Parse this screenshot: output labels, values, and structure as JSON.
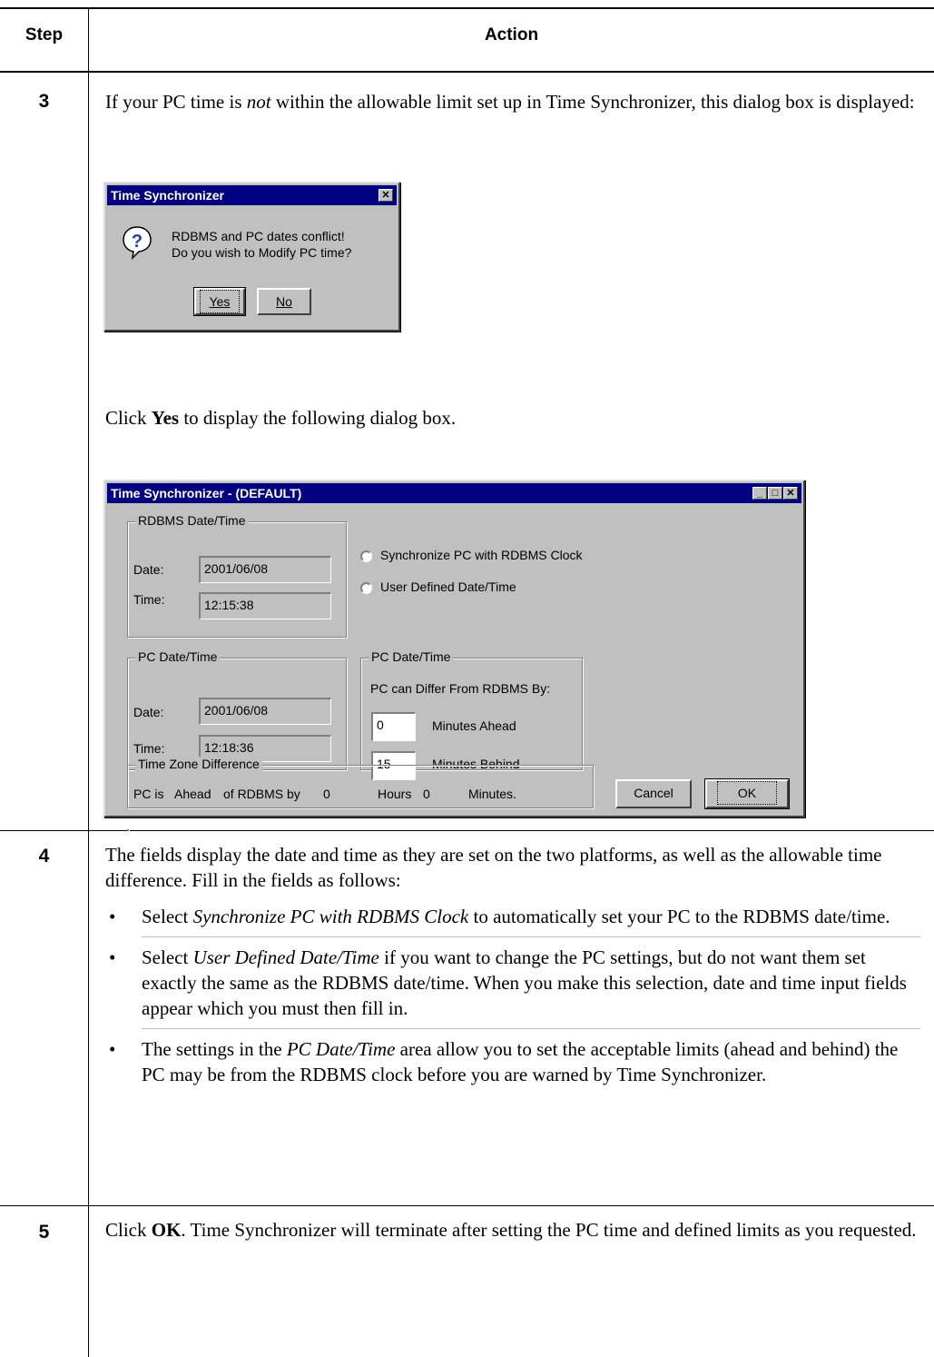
{
  "table": {
    "header_step": "Step",
    "header_action": "Action"
  },
  "step3": {
    "number": "3",
    "intro_before": "If your PC time is ",
    "intro_italic": "not",
    "intro_after": " within the allowable limit set up in Time Synchronizer, this dialog box is displayed:",
    "click_before": "Click ",
    "click_bold": "Yes",
    "click_after": " to display the following dialog box."
  },
  "confirm_dialog": {
    "title": "Time Synchronizer",
    "message_line1": "RDBMS and PC dates conflict!",
    "message_line2": "Do you wish to Modify PC time?",
    "yes_label": "Yes",
    "no_label": "No",
    "icon": "question-icon"
  },
  "main_dialog": {
    "title": "Time Synchronizer - (DEFAULT)",
    "rdbms_group": "RDBMS Date/Time",
    "date_label": "Date:",
    "time_label": "Time:",
    "rdbms_date": "2001/06/08",
    "rdbms_time": "12:15:38",
    "radio_sync": "Synchronize PC with RDBMS Clock",
    "radio_user": "User Defined Date/Time",
    "pc_group": "PC Date/Time",
    "pc_date": "2001/06/08",
    "pc_time": "12:18:36",
    "limits_group": "PC Date/Time",
    "limits_caption": "PC can Differ From RDBMS By:",
    "minutes_ahead_value": "0",
    "minutes_ahead_label": "Minutes Ahead",
    "minutes_behind_value": "15",
    "minutes_behind_label": "Minutes Behind",
    "tz_group": "Time Zone Difference",
    "tz_pc_is": "PC is",
    "tz_ahead": "Ahead",
    "tz_of_rdbms_by": "of RDBMS by",
    "tz_hours_value": "0",
    "tz_hours_label": "Hours",
    "tz_minutes_value": "0",
    "tz_minutes_label": "Minutes.",
    "cancel_label": "Cancel",
    "ok_label": "OK"
  },
  "step4": {
    "number": "4",
    "intro": "The fields display the date and time as they are set on the two platforms, as well as the allowable time difference. Fill in the fields as follows:",
    "bullet_char": "•",
    "b1_italic": "Synchronize PC with RDBMS Clock",
    "b1_after": " to automatically set your PC to the RDBMS date/time.",
    "b2_italic": "User Defined Date/Time",
    "b2_after": " if you want to change the PC settings, but do not want them set exactly the same as the RDBMS date/time. When you make this selection, date and time input fields appear which you must then fill in.",
    "b3_before": "The settings in the ",
    "b3_italic": "PC Date/Time",
    "b3_after": " area allow you to set the acceptable limits (ahead and behind) the PC may be from the RDBMS clock before you are warned by Time Synchronizer.",
    "select_word": "Select "
  },
  "step5": {
    "number": "5",
    "click_before": "Click ",
    "click_bold": "OK",
    "click_after": ". Time Synchronizer will terminate after setting the PC time and defined limits as you requested."
  }
}
